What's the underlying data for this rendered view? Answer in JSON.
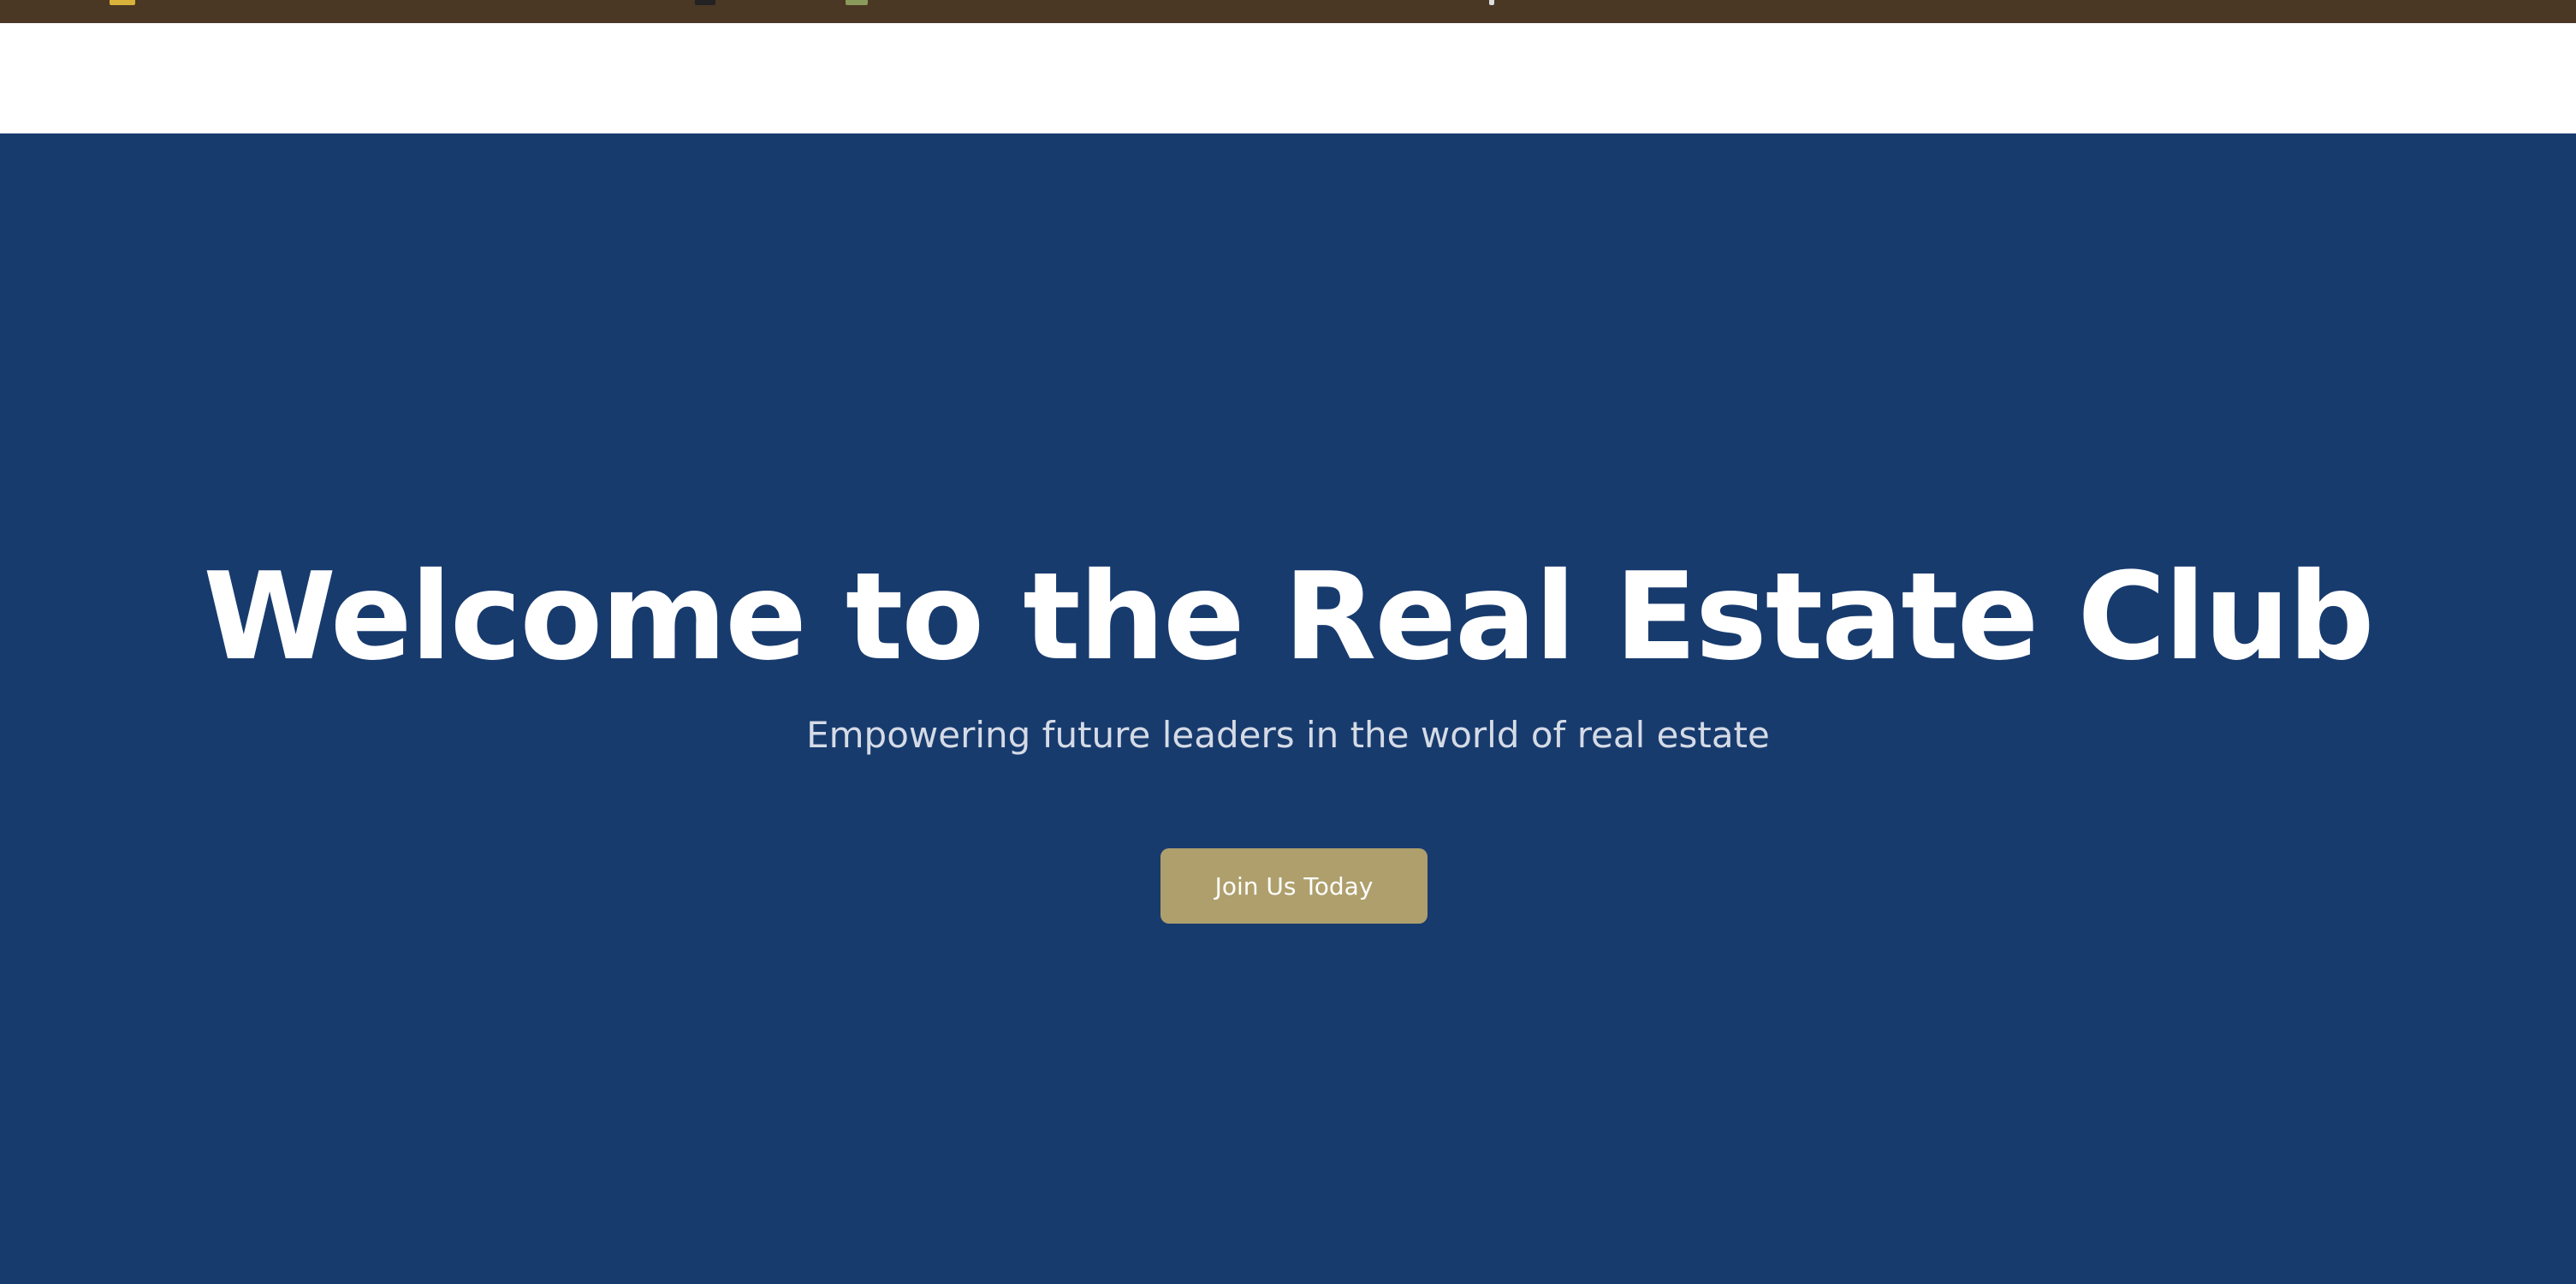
{
  "colors": {
    "browser_strip": "#4a3724",
    "navbar_background": "#ffffff",
    "hero_background": "#183b6e",
    "title_text": "#ffffff",
    "subtitle_text": "#d5dbe6",
    "cta_background": "#ae9f6c",
    "cta_text": "#ffffff"
  },
  "hero": {
    "title": "Welcome to the Real Estate Club",
    "subtitle": "Empowering future leaders in the world of real estate",
    "cta_label": "Join Us Today"
  }
}
